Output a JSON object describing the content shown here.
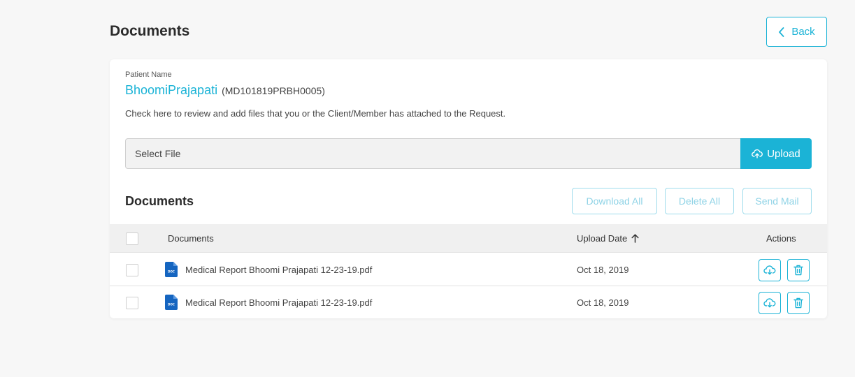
{
  "header": {
    "title": "Documents",
    "back_label": "Back"
  },
  "patient": {
    "label": "Patient Name",
    "name": "BhoomiPrajapati",
    "id": "(MD101819PRBH0005)",
    "info": "Check here to review and add files that you or the Client/Member has attached to the Request."
  },
  "upload": {
    "select_label": "Select File",
    "upload_label": "Upload"
  },
  "documents": {
    "heading": "Documents",
    "download_all": "Download All",
    "delete_all": "Delete All",
    "send_mail": "Send Mail",
    "columns": {
      "name": "Documents",
      "date": "Upload Date",
      "actions": "Actions"
    },
    "rows": [
      {
        "name": "Medical Report Bhoomi Prajapati 12-23-19.pdf",
        "date": "Oct 18, 2019",
        "icon": "doc-file-icon"
      },
      {
        "name": "Medical Report Bhoomi Prajapati 12-23-19.pdf",
        "date": "Oct 18, 2019",
        "icon": "doc-file-icon"
      }
    ]
  },
  "colors": {
    "accent": "#1bb3d6",
    "accent_light": "#9fdcec",
    "doc_icon": "#1565c0"
  }
}
